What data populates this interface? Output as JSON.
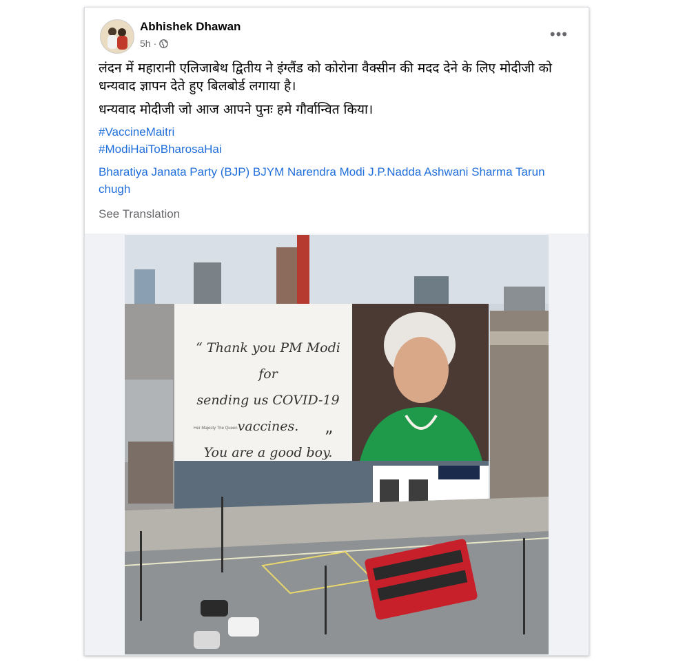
{
  "post": {
    "author": "Abhishek Dhawan",
    "time": "5h",
    "privacy_icon": "globe-icon",
    "more_label": "•••",
    "text_lines": [
      "लंदन में महारानी एलिजाबेथ द्वितीय ने इंग्लैंड को कोरोना वैक्सीन की मदद देने के लिए मोदीजी को धन्यवाद ज्ञापन देते हुए बिलबोर्ड लगाया है।",
      "धन्यवाद मोदीजी जो आज आपने पुनः हमे गौर्वान्वित किया।"
    ],
    "hashtags": [
      "#VaccineMaitri",
      "#ModiHaiToBharosaHai"
    ],
    "mentions": "Bharatiya Janata Party (BJP) BJYM Narendra Modi J.P.Nadda Ashwani Sharma Tarun chugh",
    "see_translation": "See Translation"
  },
  "billboard": {
    "line1": "“ Thank you PM Modi  for",
    "line2": "sending us COVID-19",
    "line3": "vaccines.",
    "line4": "You are a good boy.",
    "close_quote": "”",
    "signature": "Her Majesty The Queen"
  },
  "colors": {
    "link": "#216fdb",
    "muted": "#65676b",
    "bus_red": "#c8202a"
  }
}
